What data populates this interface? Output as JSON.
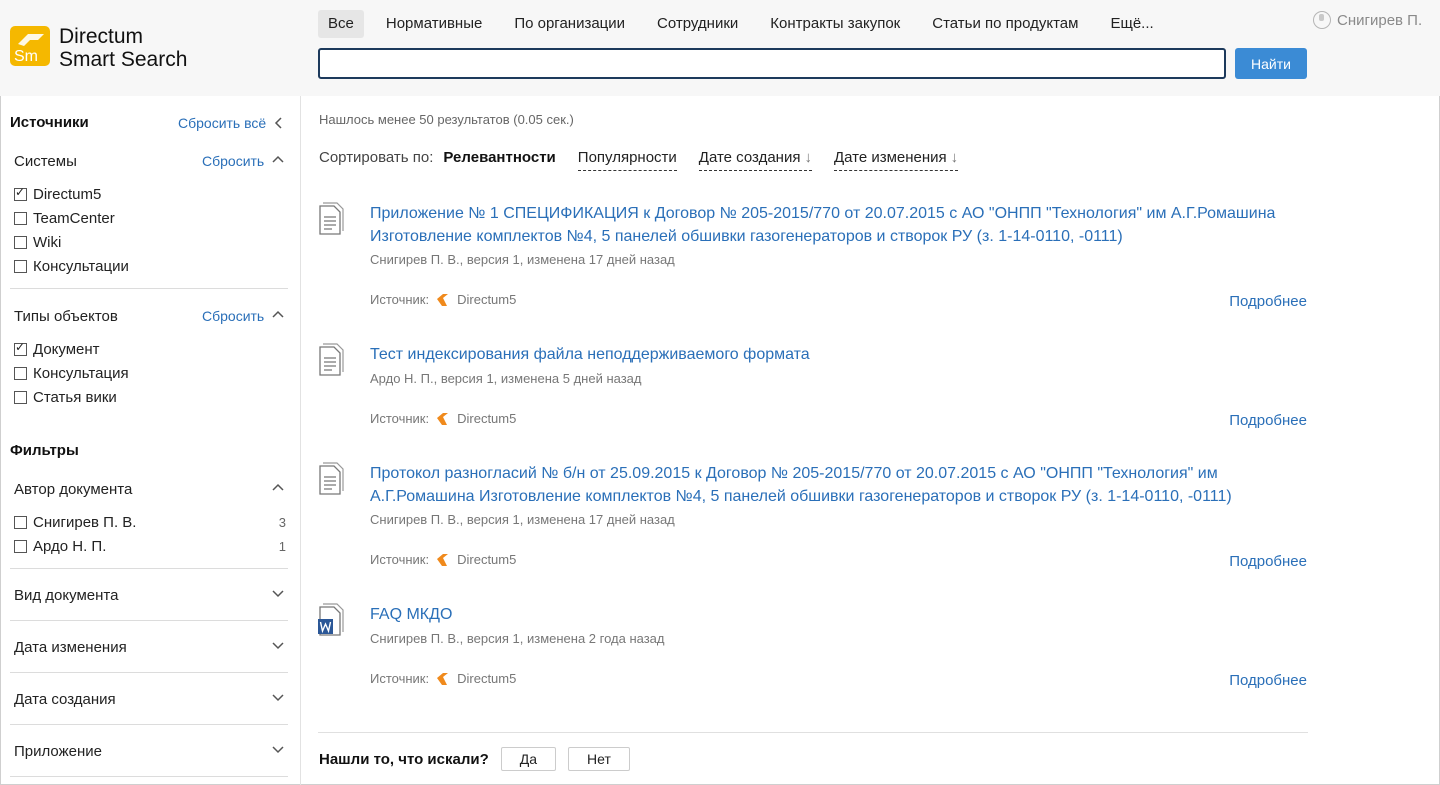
{
  "header": {
    "logo_line1": "Directum",
    "logo_line2": "Smart Search",
    "logo_mark": "Sm",
    "tabs": [
      {
        "label": "Все",
        "active": true
      },
      {
        "label": "Нормативные"
      },
      {
        "label": "По организации"
      },
      {
        "label": "Сотрудники"
      },
      {
        "label": "Контракты закупок"
      },
      {
        "label": "Статьи по продуктам"
      },
      {
        "label": "Ещё..."
      }
    ],
    "search_value": "",
    "search_button": "Найти",
    "user_name": "Снигирев П."
  },
  "sidebar": {
    "sources_title": "Источники",
    "reset_all": "Сбросить всё",
    "systems": {
      "title": "Системы",
      "reset": "Сбросить",
      "items": [
        {
          "label": "Directum5",
          "checked": true
        },
        {
          "label": "TeamCenter",
          "checked": false
        },
        {
          "label": "Wiki",
          "checked": false
        },
        {
          "label": "Консультации",
          "checked": false
        }
      ]
    },
    "object_types": {
      "title": "Типы объектов",
      "reset": "Сбросить",
      "items": [
        {
          "label": "Документ",
          "checked": true
        },
        {
          "label": "Консультация",
          "checked": false
        },
        {
          "label": "Статья вики",
          "checked": false
        }
      ]
    },
    "filters_title": "Фильтры",
    "author": {
      "title": "Автор документа",
      "items": [
        {
          "label": "Снигирев П. В.",
          "count": "3",
          "checked": false
        },
        {
          "label": "Ардо Н. П.",
          "count": "1",
          "checked": false
        }
      ]
    },
    "collapsed": [
      "Вид документа",
      "Дата изменения",
      "Дата создания",
      "Приложение"
    ]
  },
  "main": {
    "found_text": "Нашлось менее 50 результатов (0.05 сек.)",
    "sort": {
      "label": "Сортировать по:",
      "options": [
        {
          "label": "Релевантности",
          "active": true,
          "arrow": ""
        },
        {
          "label": "Популярности",
          "arrow": ""
        },
        {
          "label": "Дате создания",
          "arrow": "↓"
        },
        {
          "label": "Дате изменения",
          "arrow": "↓"
        }
      ]
    },
    "results": [
      {
        "title": "Приложение № 1 СПЕЦИФИКАЦИЯ к Договор № 205-2015/770 от 20.07.2015 с АО \"ОНПП \"Технология\" им А.Г.Ромашина Изготовление комплектов №4, 5 панелей обшивки газогенераторов и створок РУ (з. 1-14-0110, -0111)",
        "meta": "Снигирев П. В., версия 1, изменена 17 дней назад",
        "source_label": "Источник:",
        "source": "Directum5",
        "more": "Подробнее",
        "icon": "text-document-icon"
      },
      {
        "title": "Тест индексирования файла неподдерживаемого формата",
        "meta": "Ардо Н. П., версия 1, изменена 5 дней назад",
        "source_label": "Источник:",
        "source": "Directum5",
        "more": "Подробнее",
        "icon": "text-document-icon"
      },
      {
        "title": "Протокол разногласий № б/н от 25.09.2015 к Договор № 205-2015/770 от 20.07.2015 с АО \"ОНПП \"Технология\" им А.Г.Ромашина Изготовление комплектов №4, 5 панелей обшивки газогенераторов и створок РУ (з. 1-14-0110, -0111)",
        "meta": "Снигирев П. В., версия 1, изменена 17 дней назад",
        "source_label": "Источник:",
        "source": "Directum5",
        "more": "Подробнее",
        "icon": "text-document-icon"
      },
      {
        "title": "FAQ МКДО",
        "meta": "Снигирев П. В., версия 1, изменена 2 года назад",
        "source_label": "Источник:",
        "source": "Directum5",
        "more": "Подробнее",
        "icon": "word-document-icon"
      }
    ],
    "feedback": {
      "question": "Нашли то, что искали?",
      "yes": "Да",
      "no": "Нет"
    }
  },
  "colors": {
    "accent": "#3b8bd5",
    "link": "#2a6fb8",
    "logo": "#f5b800",
    "source_icon": "#f08a1c",
    "header_bg": "#f7f7f7"
  }
}
